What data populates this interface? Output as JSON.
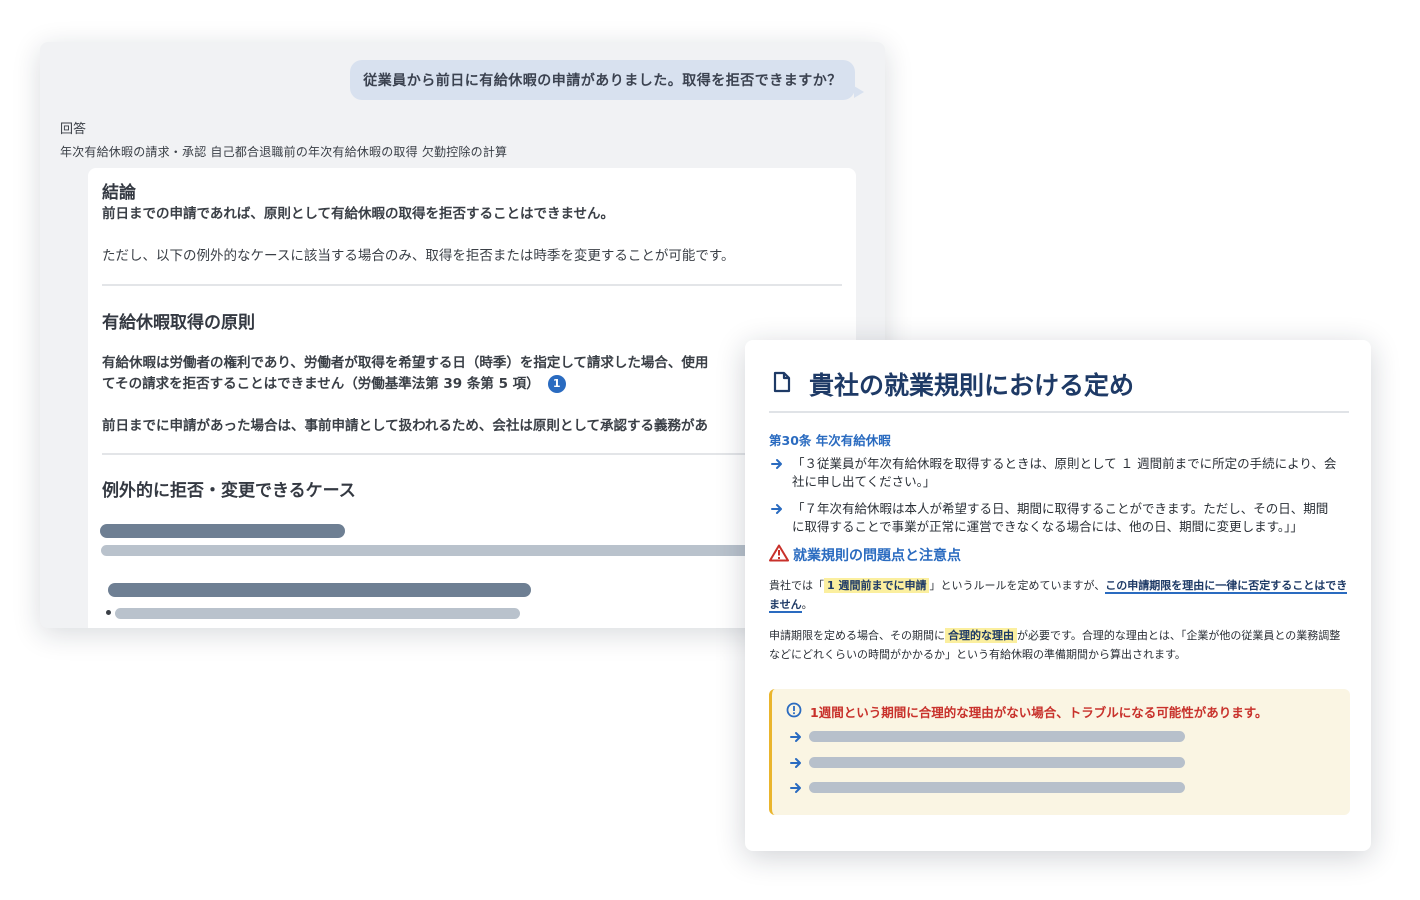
{
  "chat": {
    "user_question": "従業員から前日に有給休暇の申請がありました。取得を拒否できますか？",
    "answer_label": "回答",
    "related_topics": "年次有給休暇の請求・承認 自己都合退職前の年次有給休暇の取得 欠勤控除の計算",
    "conclusion_heading": "結論",
    "conclusion_bold": "前日までの申請であれば、原則として有給休暇の取得を拒否することはできません。",
    "conclusion_note": "ただし、以下の例外的なケースに該当する場合のみ、取得を拒否または時季を変更することが可能です。",
    "principle_heading": "有給休暇取得の原則",
    "principle_line1": "有給休暇は労働者の権利であり、労働者が取得を希望する日（時季）を指定して請求した場合、使用",
    "principle_line2": "てその請求を拒否することはできません（労働基準法第 39 条第 5 項）",
    "citation_number": "1",
    "principle_line3": "前日までに申請があった場合は、事前申請として扱われるため、会社は原則として承認する義務があ",
    "exception_heading": "例外的に拒否・変更できるケース"
  },
  "regulation": {
    "icon": "document-icon",
    "title": "貴社の就業規則における定め",
    "article_title": "第30条 年次有給休暇",
    "quote1": "「３従業員が年次有給休暇を取得するときは、原則として １ 週間前までに所定の手続により、会社に申し出てください。」",
    "quote2": "「７年次有給休暇は本人が希望する日、期間に取得することができます。ただし、その日、期間に取得することで事業が正常に運営できなくなる場合には、他の日、期間に変更します。」」",
    "issues_heading": "就業規則の問題点と注意点",
    "para1_prefix": "貴社では「",
    "para1_highlight": "1 週間前までに申請",
    "para1_middle": "」というルールを定めていますが、",
    "para1_underline": "この申請期限を理由に一律に否定することはできません",
    "para1_suffix": "。",
    "para2_prefix": "申請期限を定める場合、その期間に",
    "para2_highlight": "合理的な理由",
    "para2_suffix": "が必要です。合理的な理由とは、「企業が他の従業員との業務調整などにどれくらいの時間がかかるか」という有給休暇の準備期間から算出されます。",
    "warning_text": "1週間という期間に合理的な理由がない場合、トラブルになる可能性があります。",
    "colors": {
      "accent": "#2a6bc0",
      "title": "#1e3a66",
      "warning": "#c8312b",
      "highlight": "#fbef9f",
      "warning_bg": "#faf5e3"
    }
  }
}
